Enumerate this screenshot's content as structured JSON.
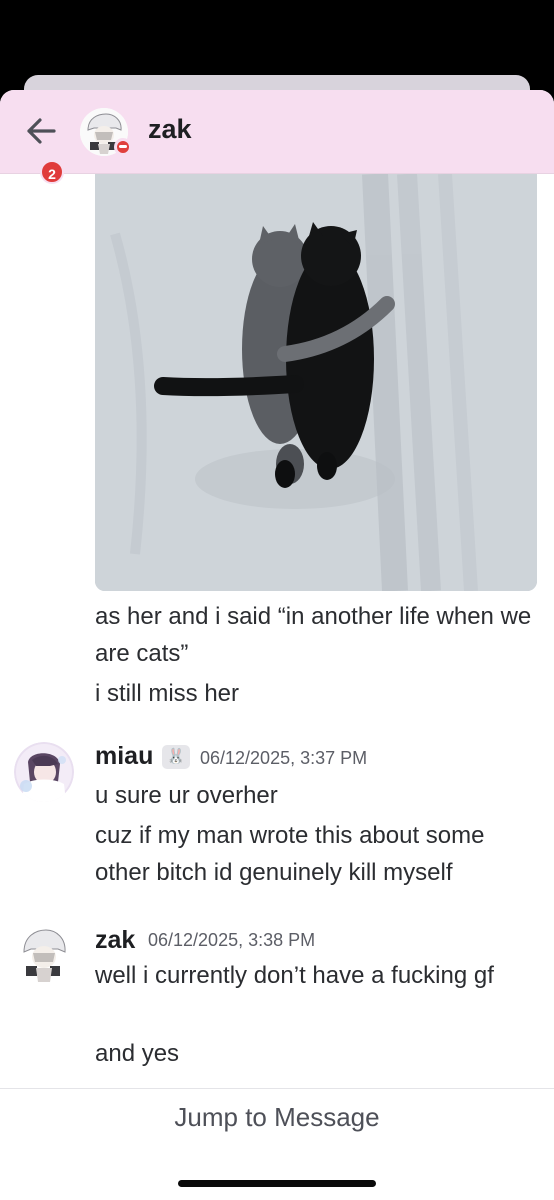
{
  "header": {
    "back_badge": "2",
    "title": "zak",
    "back_icon": "arrow-left-icon",
    "status": "do-not-disturb"
  },
  "messages": {
    "continued": {
      "line1": "as her and i said “in another life when we are cats”",
      "line2": "i still miss her"
    },
    "miau": {
      "username": "miau",
      "role_icon": "🐰",
      "timestamp": "06/12/2025, 3:37 PM",
      "line1": "u sure ur overher",
      "line2": "cuz if my man wrote this about some other bitch id genuinely kill myself"
    },
    "zak": {
      "username": "zak",
      "timestamp": "06/12/2025, 3:38 PM",
      "line1": "well i currently don’t have a fucking gf",
      "line2": "and yes"
    }
  },
  "footer": {
    "jump_label": "Jump to Message"
  },
  "colors": {
    "header_bg": "#f7def0",
    "badge": "#e03b3b",
    "dnd": "#e0403c"
  }
}
